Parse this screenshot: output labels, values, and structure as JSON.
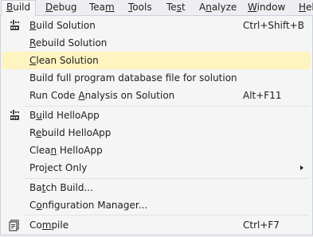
{
  "menubar": {
    "items": [
      {
        "label": "Build",
        "key": "B",
        "rest": "uild"
      },
      {
        "label": "Debug",
        "key": "D",
        "rest": "ebug"
      },
      {
        "label": "Team",
        "key": "m",
        "pre": "Tea",
        "rest": ""
      },
      {
        "label": "Tools",
        "key": "T",
        "rest": "ools"
      },
      {
        "label": "Test",
        "key": "s",
        "pre": "Te",
        "rest": "t"
      },
      {
        "label": "Analyze",
        "key": "n",
        "pre": "A",
        "rest": "alyze"
      },
      {
        "label": "Window",
        "key": "W",
        "rest": "indow"
      },
      {
        "label": "Help",
        "key": "H",
        "rest": "el"
      }
    ]
  },
  "menu": {
    "items": [
      {
        "label": "Build Solution",
        "pre": "",
        "key": "B",
        "rest": "uild Solution",
        "shortcut": "Ctrl+Shift+B",
        "icon": "build-solution-icon"
      },
      {
        "label": "Rebuild Solution",
        "pre": "",
        "key": "R",
        "rest": "ebuild Solution",
        "shortcut": ""
      },
      {
        "label": "Clean Solution",
        "pre": "",
        "key": "C",
        "rest": "lean Solution",
        "shortcut": "",
        "highlighted": true
      },
      {
        "label": "Build full program database file for solution",
        "shortcut": ""
      },
      {
        "label": "Run Code Analysis on Solution",
        "pre": "Run Code ",
        "key": "A",
        "rest": "nalysis on Solution",
        "shortcut": "Alt+F11"
      },
      {
        "label": "Build HelloApp",
        "pre": "B",
        "key": "u",
        "rest": "ild HelloApp",
        "shortcut": "",
        "icon": "build-project-icon"
      },
      {
        "label": "Rebuild HelloApp",
        "pre": "R",
        "key": "e",
        "rest": "build HelloApp",
        "shortcut": ""
      },
      {
        "label": "Clean HelloApp",
        "pre": "Clea",
        "key": "n",
        "rest": " HelloApp",
        "shortcut": ""
      },
      {
        "label": "Project Only",
        "pre": "Pro",
        "key": "j",
        "rest": "ect Only",
        "shortcut": "",
        "submenu": true
      },
      {
        "label": "Batch Build...",
        "pre": "Ba",
        "key": "t",
        "rest": "ch Build...",
        "shortcut": ""
      },
      {
        "label": "Configuration Manager...",
        "pre": "C",
        "key": "o",
        "rest": "nfiguration Manager...",
        "shortcut": ""
      },
      {
        "label": "Compile",
        "pre": "Co",
        "key": "m",
        "rest": "pile",
        "shortcut": "Ctrl+F7",
        "icon": "compile-icon"
      }
    ]
  },
  "colors": {
    "highlight": "#fdf4bf",
    "menu_bg": "#f5f5f5",
    "menubar_bg": "#eeeef2",
    "border": "#cccedb"
  }
}
